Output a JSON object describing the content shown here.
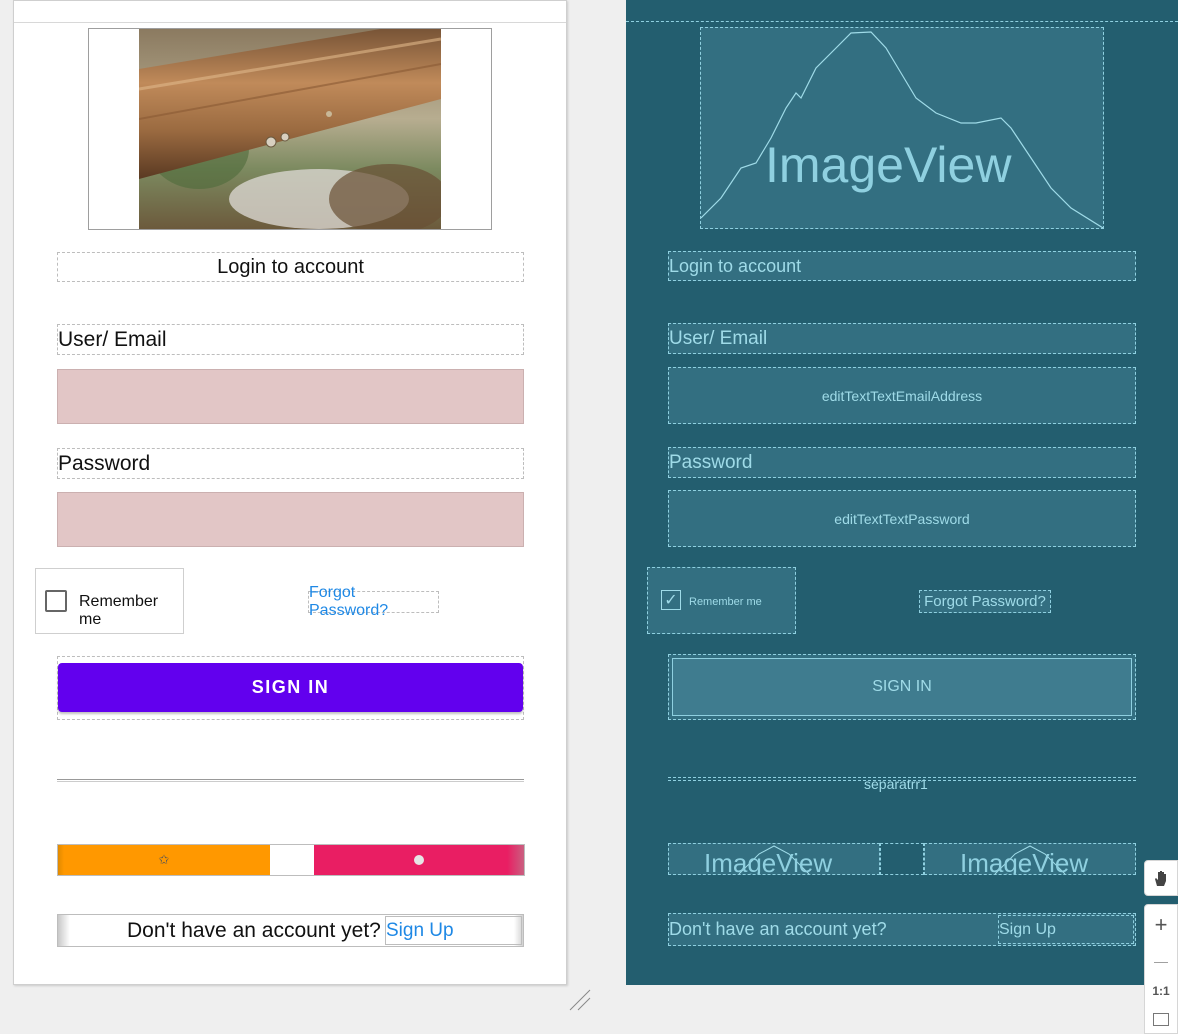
{
  "design": {
    "title_text": "Login to account",
    "user_label": "User/ Email",
    "password_label": "Password",
    "remember_label": "Remember me",
    "forgot_link": "Forgot Password?",
    "sign_in_button": "SIGN IN",
    "no_account_text": "Don't have an account yet?",
    "sign_up_link": "Sign Up",
    "colors": {
      "button": "#6200ee",
      "field": "#e2c6c6",
      "orange": "#ff9800",
      "pink": "#e91e63",
      "link": "#1e88e5"
    }
  },
  "blueprint": {
    "top_image_label": "ImageView",
    "title_text": "Login to account",
    "user_label": "User/ Email",
    "email_field_id": "editTextTextEmailAddress",
    "password_label": "Password",
    "password_field_id": "editTextTextPassword",
    "remember_label": "Remember me",
    "forgot_link": "Forgot Password?",
    "sign_in_button": "SIGN IN",
    "separator_label": "separatrr1",
    "image_left_label": "ImageView",
    "image_right_label": "ImageView",
    "no_account_text": "Don't have an account yet?",
    "sign_up_link": "Sign Up",
    "colors": {
      "background": "#235e6f",
      "outline": "#8fd0e0"
    }
  },
  "zoom_controls": {
    "pan_icon": "hand-icon",
    "zoom_in": "+",
    "zoom_out": "—",
    "actual_size": "1:1",
    "fit_icon": "fit-screen-icon"
  }
}
